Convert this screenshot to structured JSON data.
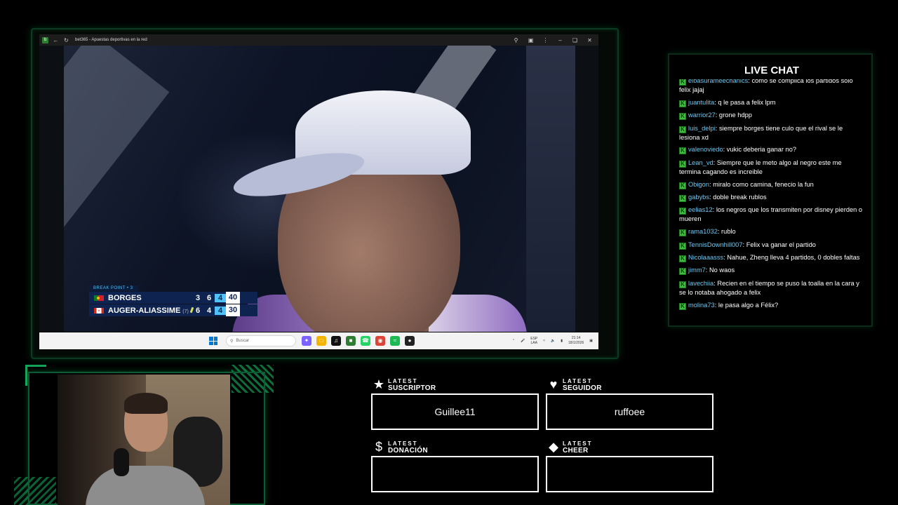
{
  "browser": {
    "title": "bet365 - Apuestas deportivas en la red",
    "favicon_label": "b"
  },
  "scoreboard": {
    "label": "BREAK POINT • 3",
    "players": [
      {
        "name": "BORGES",
        "seed": "",
        "sets": [
          "3",
          "6",
          "4"
        ],
        "points": "40"
      },
      {
        "name": "AUGER-ALIASSIME",
        "seed": "(7)",
        "sets": [
          "6",
          "4",
          "4"
        ],
        "points": "30"
      }
    ]
  },
  "taskbar": {
    "search_placeholder": "Buscar",
    "ime_top": "ESP",
    "ime_bottom": "LAA",
    "time": "21:14",
    "date": "18/1/2026"
  },
  "chat": {
    "title": "LIVE CHAT",
    "messages": [
      {
        "user": "elbasurameechanics",
        "text": "como se complica los partidos solo felix jajaj"
      },
      {
        "user": "juantulita",
        "text": "q le pasa a felix lpm"
      },
      {
        "user": "warrior27",
        "text": "grone hdpp"
      },
      {
        "user": "luis_delpi",
        "text": "siempre borges tiene culo que el rival se le lesiona xd"
      },
      {
        "user": "valenoviedo",
        "text": "vukic deberia ganar no?"
      },
      {
        "user": "Lean_vd",
        "text": "Siempre que le meto algo al negro este me termina cagando es increible"
      },
      {
        "user": "Obigon",
        "text": "miralo como camina, fenecio la fun"
      },
      {
        "user": "gabybs",
        "text": "doble break rublos"
      },
      {
        "user": "eelias12",
        "text": "los negros que los transmiten por disney pierden o mueren"
      },
      {
        "user": "rama1032",
        "text": "rublo"
      },
      {
        "user": "TennisDownhill007",
        "text": "Felix va ganar el partido"
      },
      {
        "user": "Nicolaaasss",
        "text": "Nahue, Zheng lleva 4 partidos, 0 dobles faltas"
      },
      {
        "user": "jimm7",
        "text": "No waos"
      },
      {
        "user": "lavechiia",
        "text": "Recien en el tiempo se puso la toalla en la cara y se lo notaba ahogado a felix"
      },
      {
        "user": "molina73",
        "text": "le pasa algo a Félix?"
      }
    ]
  },
  "alerts": {
    "subscriber": {
      "small": "LATEST",
      "big": "SUSCRIPTOR",
      "value": "Guillee11",
      "icon": "star-icon"
    },
    "follower": {
      "small": "LATEST",
      "big": "SEGUIDOR",
      "value": "ruffoee",
      "icon": "heart-icon"
    },
    "donation": {
      "small": "LATEST",
      "big": "DONACIÓN",
      "value": "",
      "icon": "dollar-icon"
    },
    "cheer": {
      "small": "LATEST",
      "big": "CHEER",
      "value": "",
      "icon": "diamond-icon"
    }
  },
  "colors": {
    "accent": "#13a35a",
    "chat_user": "#6ec6f0",
    "score_bg": "#0e2350"
  }
}
